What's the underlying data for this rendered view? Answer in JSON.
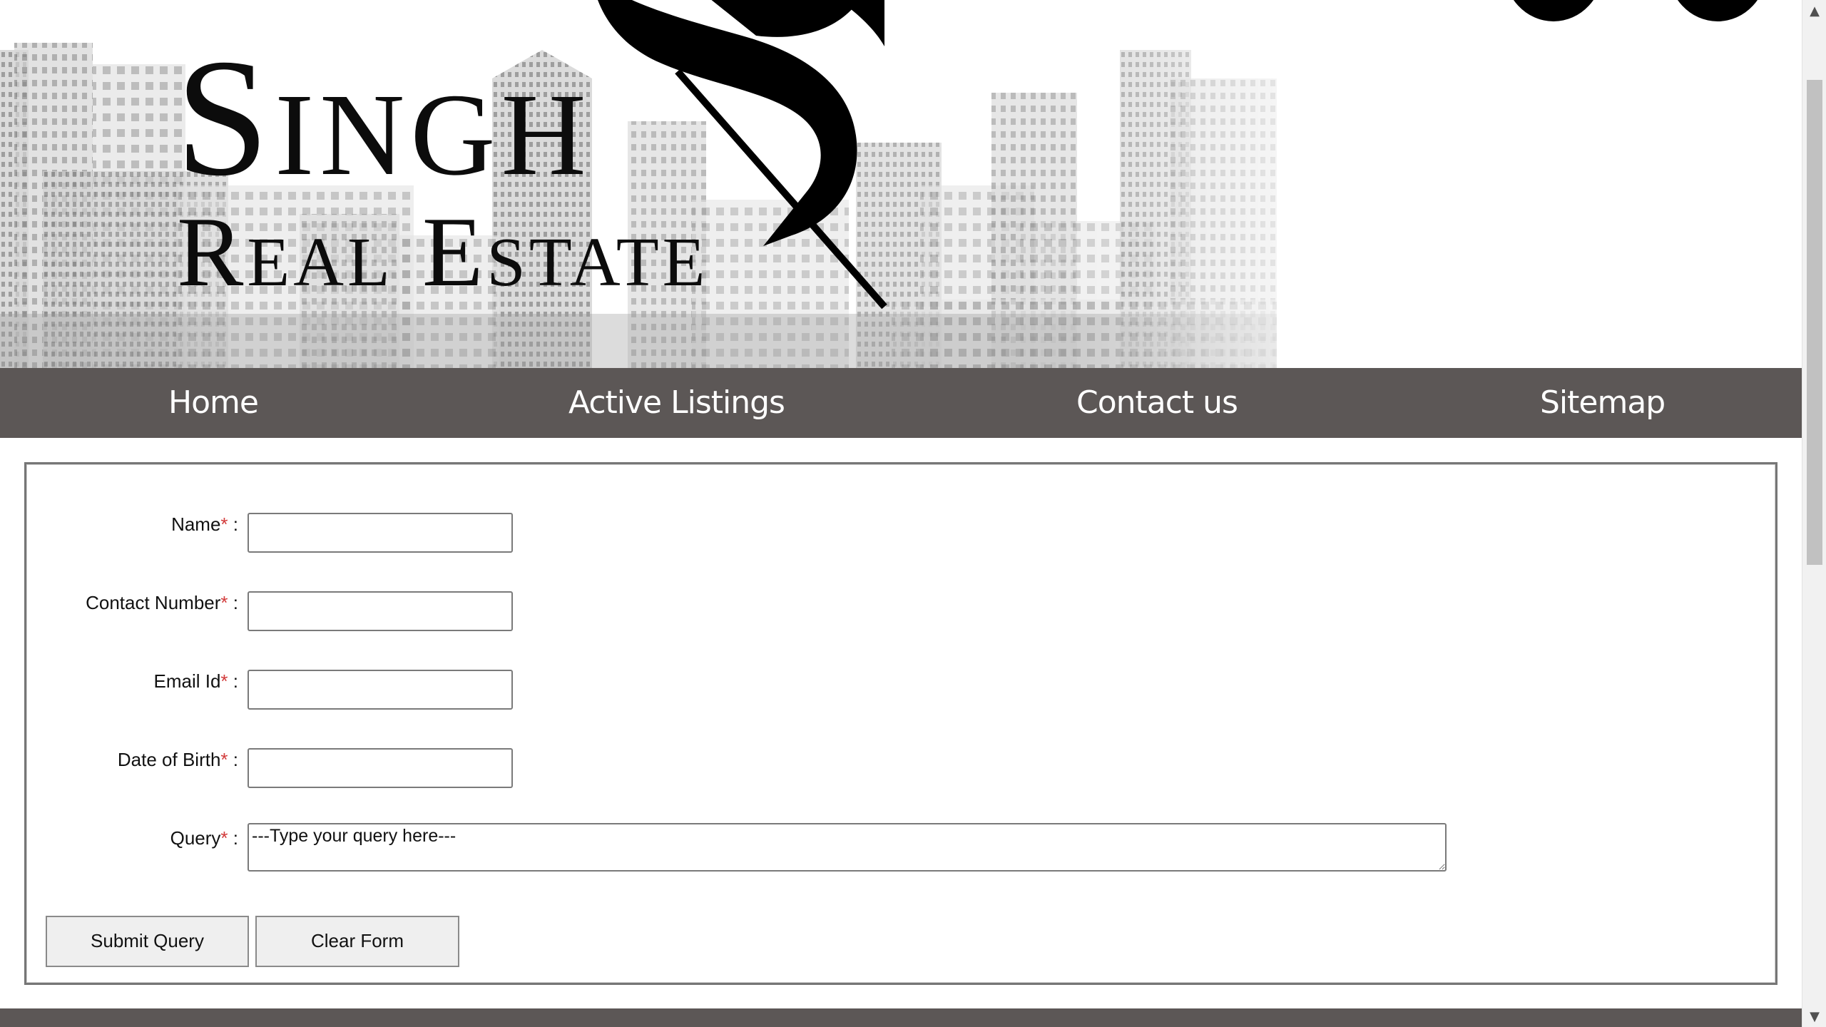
{
  "brand": {
    "logo_line1": "Singh",
    "logo_line2": "Real Estate"
  },
  "nav": {
    "items": [
      {
        "label": "Home"
      },
      {
        "label": "Active Listings"
      },
      {
        "label": "Contact us"
      },
      {
        "label": "Sitemap"
      }
    ]
  },
  "form": {
    "fields": [
      {
        "label": "Name",
        "required_mark": "*",
        "separator": " :",
        "value": ""
      },
      {
        "label": "Contact Number",
        "required_mark": "*",
        "separator": " :",
        "value": ""
      },
      {
        "label": "Email Id",
        "required_mark": "*",
        "separator": " :",
        "value": ""
      },
      {
        "label": "Date of Birth",
        "required_mark": "*",
        "separator": " :",
        "value": ""
      }
    ],
    "query": {
      "label": "Query",
      "required_mark": "*",
      "separator": " :",
      "value": "---Type your query here---"
    },
    "submit_label": "Submit Query",
    "clear_label": "Clear Form"
  },
  "colors": {
    "nav_background": "#5c5756",
    "required_mark": "#d23a3a",
    "form_border": "#767676"
  }
}
